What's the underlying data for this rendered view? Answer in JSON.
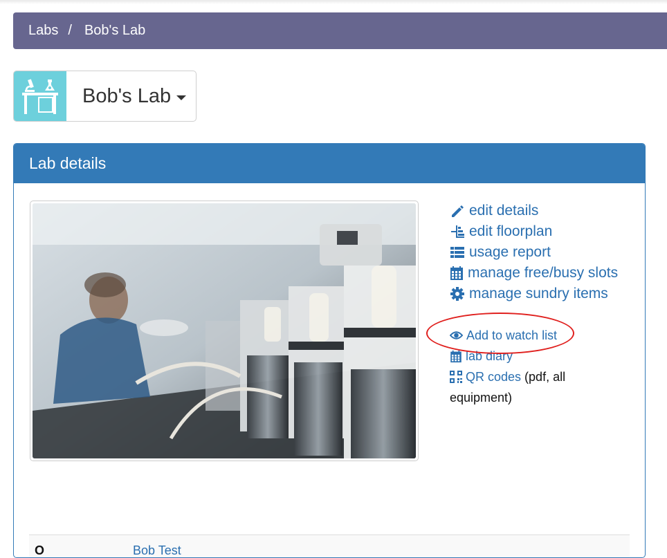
{
  "breadcrumb": {
    "root": "Labs",
    "separator": "/",
    "current": "Bob's Lab"
  },
  "lab_selector": {
    "name": "Bob's Lab"
  },
  "panel": {
    "title": "Lab details"
  },
  "actions": {
    "primary": [
      {
        "label": "edit details",
        "icon": "pencil-icon"
      },
      {
        "label": "edit floorplan",
        "icon": "floorplan-icon"
      },
      {
        "label": "usage report",
        "icon": "list-icon"
      },
      {
        "label": "manage free/busy slots",
        "icon": "calendar-icon"
      },
      {
        "label": "manage sundry items",
        "icon": "gear-icon"
      }
    ],
    "watch": {
      "label": "Add to watch list",
      "icon": "eye-icon"
    },
    "diary": {
      "label": "lab diary",
      "icon": "calendar-icon"
    },
    "qr": {
      "link": "QR codes",
      "suffix": " (pdf, all equipment)",
      "icon": "qr-code-icon"
    }
  },
  "bottom_row": {
    "label": "O",
    "value": "Bob Test"
  },
  "colors": {
    "breadcrumb_bg": "#67668f",
    "panel_primary": "#337ab7",
    "logo_bg": "#6dd0dc",
    "link": "#2a6fb0",
    "annotation": "#e0201e"
  }
}
